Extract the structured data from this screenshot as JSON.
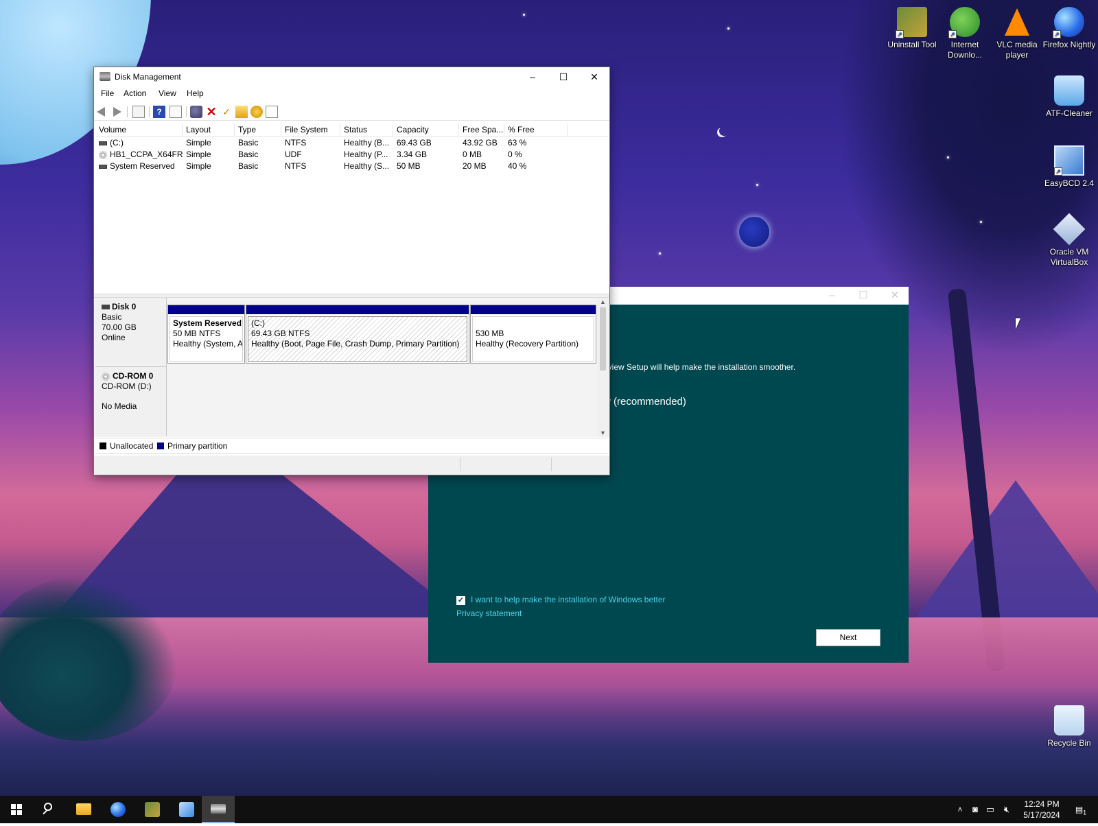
{
  "desktop": {
    "icons": [
      {
        "label": "Uninstall Tool"
      },
      {
        "label": "Internet Downlo..."
      },
      {
        "label": "VLC media player"
      },
      {
        "label": "Firefox Nightly"
      },
      {
        "label": "ATF-Cleaner"
      },
      {
        "label": "EasyBCD 2.4"
      },
      {
        "label": "Oracle VM VirtualBox"
      },
      {
        "label": "Recycle Bin"
      }
    ]
  },
  "setup_window": {
    "text_partial": "eview Setup will help make the installation smoother.",
    "option_partial": "w (recommended)",
    "checkbox_label": "I want to help make the installation of Windows better",
    "checkbox_checked": true,
    "privacy_link": "Privacy statement",
    "next_button": "Next"
  },
  "disk_management": {
    "title": "Disk Management",
    "menu": [
      "File",
      "Action",
      "View",
      "Help"
    ],
    "columns": [
      "Volume",
      "Layout",
      "Type",
      "File System",
      "Status",
      "Capacity",
      "Free Spa...",
      "% Free"
    ],
    "rows": [
      {
        "volume": "(C:)",
        "layout": "Simple",
        "type": "Basic",
        "fs": "NTFS",
        "status": "Healthy (B...",
        "capacity": "69.43 GB",
        "free": "43.92 GB",
        "pct": "63 %",
        "icon": "drive"
      },
      {
        "volume": "HB1_CCPA_X64FR...",
        "layout": "Simple",
        "type": "Basic",
        "fs": "UDF",
        "status": "Healthy (P...",
        "capacity": "3.34 GB",
        "free": "0 MB",
        "pct": "0 %",
        "icon": "cd"
      },
      {
        "volume": "System Reserved",
        "layout": "Simple",
        "type": "Basic",
        "fs": "NTFS",
        "status": "Healthy (S...",
        "capacity": "50 MB",
        "free": "20 MB",
        "pct": "40 %",
        "icon": "drive"
      }
    ],
    "disks": {
      "disk0": {
        "name": "Disk 0",
        "kind": "Basic",
        "size": "70.00 GB",
        "state": "Online",
        "partitions": [
          {
            "title": "System Reserved",
            "size": "50 MB NTFS",
            "status": "Healthy (System, A"
          },
          {
            "title": "(C:)",
            "size": "69.43 GB NTFS",
            "status": "Healthy (Boot, Page File, Crash Dump, Primary Partition)"
          },
          {
            "title": "",
            "size": "530 MB",
            "status": "Healthy (Recovery Partition)"
          }
        ]
      },
      "cdrom0": {
        "name": "CD-ROM 0",
        "drive": "CD-ROM (D:)",
        "state": "No Media"
      }
    },
    "legend": {
      "unallocated": "Unallocated",
      "primary": "Primary partition"
    },
    "colors": {
      "primary_partition": "#00008c",
      "unallocated": "#000000"
    }
  },
  "taskbar": {
    "time": "12:24 PM",
    "date": "5/17/2024",
    "notification_count": "1"
  }
}
